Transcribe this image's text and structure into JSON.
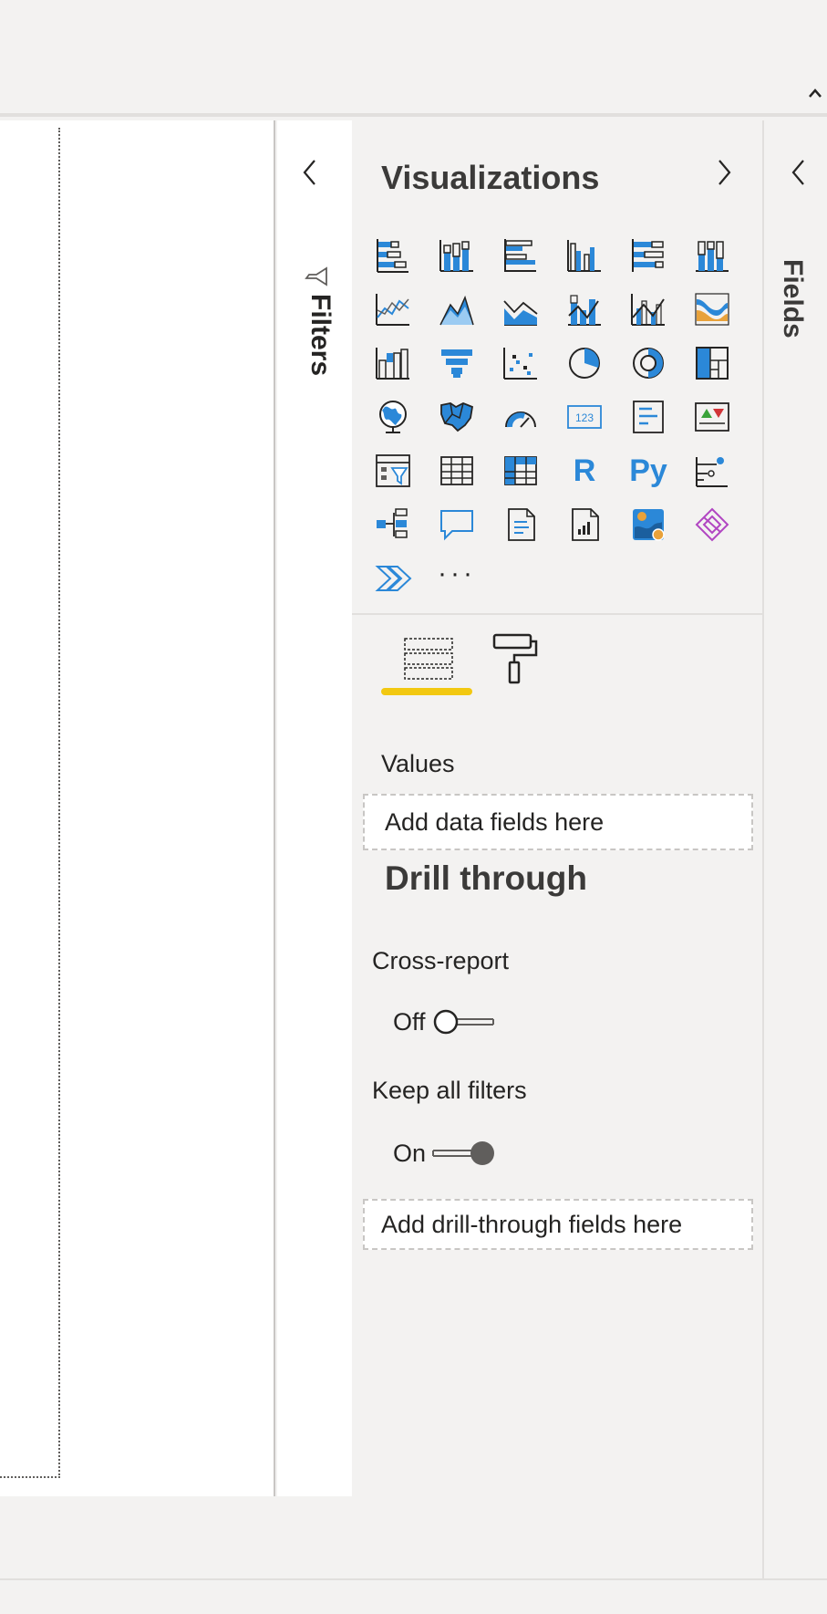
{
  "visualizations": {
    "title": "Visualizations",
    "icons": [
      [
        "stacked-bar-chart-icon",
        "stacked-column-chart-icon",
        "clustered-bar-chart-icon",
        "clustered-column-chart-icon",
        "100-stacked-bar-chart-icon",
        "100-stacked-column-chart-icon"
      ],
      [
        "line-chart-icon",
        "area-chart-icon",
        "stacked-area-chart-icon",
        "line-and-stacked-column-chart-icon",
        "line-and-clustered-column-chart-icon",
        "ribbon-chart-icon"
      ],
      [
        "waterfall-chart-icon",
        "funnel-icon",
        "scatter-chart-icon",
        "pie-chart-icon",
        "donut-chart-icon",
        "treemap-icon"
      ],
      [
        "map-icon",
        "filled-map-icon",
        "gauge-icon",
        "card-icon",
        "multi-row-card-icon",
        "kpi-icon"
      ],
      [
        "slicer-icon",
        "table-icon",
        "matrix-icon",
        "r-visual-icon",
        "python-visual-icon",
        "key-influencers-icon"
      ],
      [
        "decomposition-tree-icon",
        "qa-icon",
        "smart-narrative-icon",
        "paginated-report-icon",
        "arcgis-map-icon",
        "power-apps-icon"
      ],
      [
        "power-automate-icon",
        "more-visuals-icon"
      ]
    ],
    "r_label": "R",
    "py_label": "Py",
    "more_label": "···"
  },
  "build": {
    "values_label": "Values",
    "values_placeholder": "Add data fields here"
  },
  "drill_through": {
    "heading": "Drill through",
    "cross_report_label": "Cross-report",
    "cross_report_state": "Off",
    "keep_filters_label": "Keep all filters",
    "keep_filters_state": "On",
    "drill_placeholder": "Add drill-through fields here"
  },
  "filters": {
    "label": "Filters"
  },
  "fields": {
    "label": "Fields"
  },
  "colors": {
    "accent_yellow": "#f2c811",
    "icon_blue": "#2b88d8",
    "icon_gray": "#605e5c",
    "power_apps_purple": "#b146c2"
  }
}
